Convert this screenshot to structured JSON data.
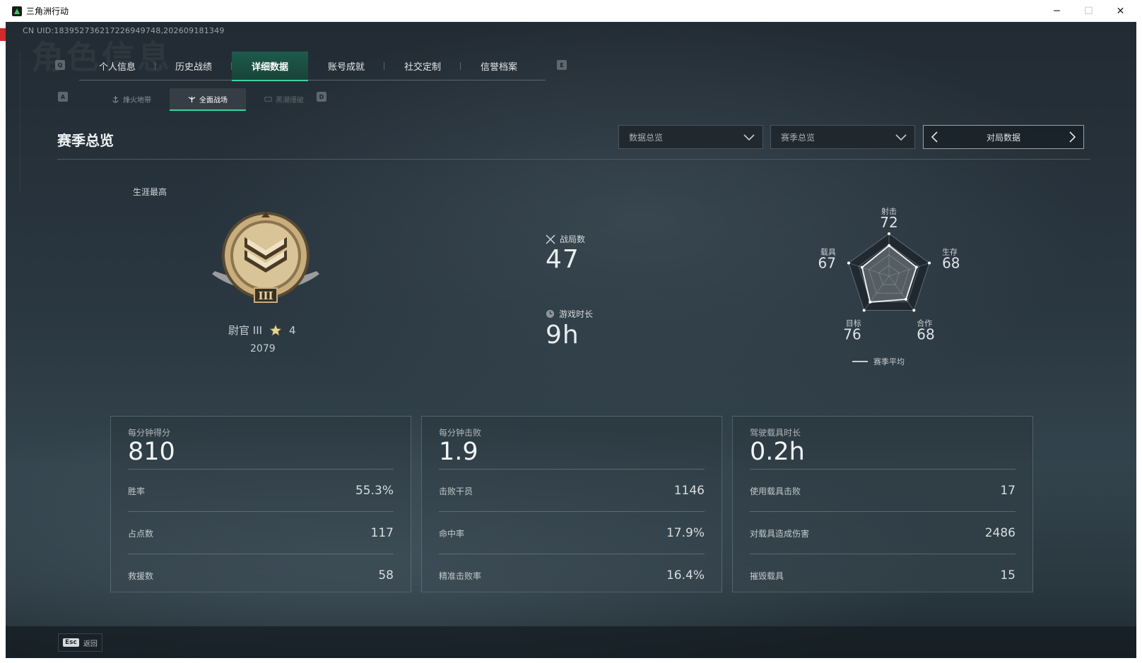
{
  "window": {
    "title": "三角洲行动",
    "controls": [
      "─",
      "☐",
      "✕"
    ]
  },
  "uid": "CN UID:1839527362172269497​48,202609181349",
  "watermark": "角色信息",
  "keys": {
    "tab_left": "Q",
    "tab_right": "E",
    "sub_left": "A",
    "sub_right": "D"
  },
  "tabs": [
    {
      "label": "个人信息"
    },
    {
      "label": "历史战绩"
    },
    {
      "label": "详细数据"
    },
    {
      "label": "账号成就"
    },
    {
      "label": "社交定制"
    },
    {
      "label": "信誉档案"
    }
  ],
  "subtabs": [
    {
      "label": "烽火地带"
    },
    {
      "label": "全面战场"
    },
    {
      "label": "黑潮爆破"
    }
  ],
  "section": {
    "title": "赛季总览",
    "dropdown1": "数据总览",
    "dropdown2": "赛季总览",
    "pager": "对局数据"
  },
  "career": {
    "label": "生涯最高",
    "rank": "尉官 III",
    "stars": "4",
    "score": "2079"
  },
  "mid": {
    "matches_label": "战局数",
    "matches_value": "47",
    "playtime_label": "游戏时长",
    "playtime_value": "9h"
  },
  "radar": {
    "axes": [
      {
        "label": "射击",
        "value": 72
      },
      {
        "label": "生存",
        "value": 68
      },
      {
        "label": "合作",
        "value": 68
      },
      {
        "label": "目标",
        "value": 76
      },
      {
        "label": "载具",
        "value": 67
      }
    ],
    "legend": "赛季平均"
  },
  "cards": [
    {
      "title": "每分钟得分",
      "main": "810",
      "rows": [
        {
          "k": "胜率",
          "v": "55.3%"
        },
        {
          "k": "占点数",
          "v": "117"
        },
        {
          "k": "救援数",
          "v": "58"
        }
      ]
    },
    {
      "title": "每分钟击败",
      "main": "1.9",
      "rows": [
        {
          "k": "击败干员",
          "v": "1146"
        },
        {
          "k": "命中率",
          "v": "17.9%"
        },
        {
          "k": "精准击败率",
          "v": "16.4%"
        }
      ]
    },
    {
      "title": "驾驶载具时长",
      "main": "0.2h",
      "rows": [
        {
          "k": "使用载具击败",
          "v": "17"
        },
        {
          "k": "对载具造成伤害",
          "v": "2486"
        },
        {
          "k": "摧毁载具",
          "v": "15"
        }
      ]
    }
  ],
  "bottom": {
    "esc_key": "Esc",
    "back": "返回"
  },
  "colors": {
    "accent": "#38d6a0",
    "tab_active_bg": "#1d5a4c"
  }
}
